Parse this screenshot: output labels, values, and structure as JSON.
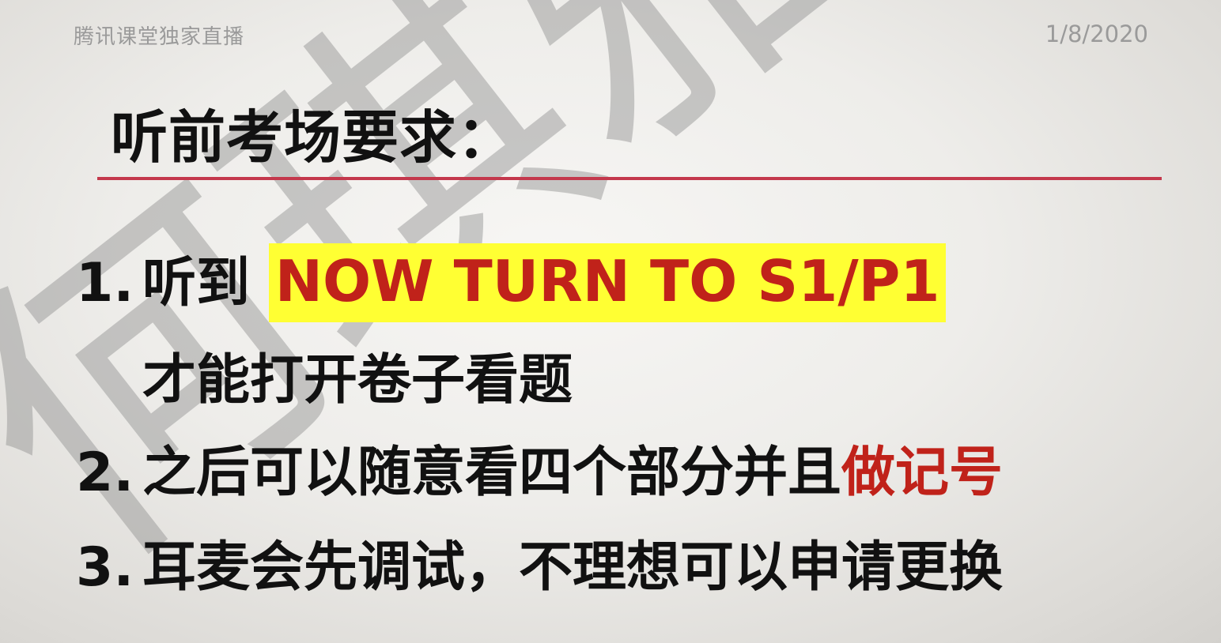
{
  "header": {
    "left_text": "腾讯课堂独家直播",
    "date": "1/8/2020"
  },
  "watermark": {
    "text": "何琪雅"
  },
  "slide": {
    "title": "听前考场要求：",
    "items": [
      {
        "number": "1.",
        "prefix": "听到 ",
        "highlight": "NOW TURN TO S1/P1",
        "continuation": "才能打开卷子看题"
      },
      {
        "number": "2.",
        "text": "之后可以随意看四个部分并且",
        "accent": "做记号"
      },
      {
        "number": "3.",
        "text": "耳麦会先调试，不理想可以申请更换"
      }
    ]
  },
  "colors": {
    "accent_red": "#c0221a",
    "highlight_yellow": "#ffff33",
    "rule_red": "#c4384c"
  }
}
